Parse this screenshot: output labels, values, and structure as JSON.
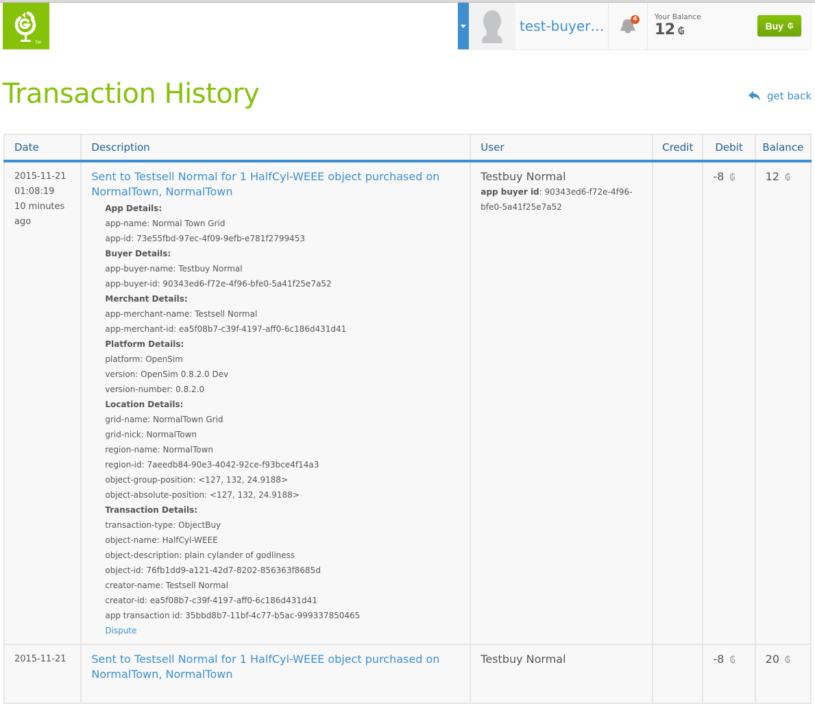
{
  "header": {
    "logo_tm": "TM",
    "username": "test-buyer…",
    "notifications_count": "4",
    "balance_label": "Your Balance",
    "balance_value": "12",
    "currency_symbol": "₲",
    "buy_label": "Buy"
  },
  "page": {
    "title": "Transaction History",
    "back_label": "get back"
  },
  "table": {
    "columns": [
      "Date",
      "Description",
      "User",
      "Credit",
      "Debit",
      "Balance"
    ],
    "rows": [
      {
        "date": "2015-11-21",
        "time": "01:08:19",
        "relative_1": "10 minutes",
        "relative_2": "ago",
        "description": "Sent to Testsell Normal for 1 HalfCyl-WEEE object purchased on NormalTown, NormalTown",
        "details": [
          {
            "type": "heading",
            "text": "App Details:"
          },
          {
            "type": "line",
            "text": "app-name: Normal Town Grid"
          },
          {
            "type": "line",
            "text": "app-id: 73e55fbd-97ec-4f09-9efb-e781f2799453"
          },
          {
            "type": "heading",
            "text": "Buyer Details:"
          },
          {
            "type": "line",
            "text": "app-buyer-name: Testbuy Normal"
          },
          {
            "type": "line",
            "text": "app-buyer-id: 90343ed6-f72e-4f96-bfe0-5a41f25e7a52"
          },
          {
            "type": "heading",
            "text": "Merchant Details:"
          },
          {
            "type": "line",
            "text": "app-merchant-name: Testsell Normal"
          },
          {
            "type": "line",
            "text": "app-merchant-id: ea5f08b7-c39f-4197-aff0-6c186d431d41"
          },
          {
            "type": "heading",
            "text": "Platform Details:"
          },
          {
            "type": "line",
            "text": "platform: OpenSim"
          },
          {
            "type": "line",
            "text": "version: OpenSim 0.8.2.0 Dev"
          },
          {
            "type": "line",
            "text": "version-number: 0.8.2.0"
          },
          {
            "type": "heading",
            "text": "Location Details:"
          },
          {
            "type": "line",
            "text": "grid-name: NormalTown Grid"
          },
          {
            "type": "line",
            "text": "grid-nick: NormalTown"
          },
          {
            "type": "line",
            "text": "region-name: NormalTown"
          },
          {
            "type": "line",
            "text": "region-id: 7aeedb84-90e3-4042-92ce-f93bce4f14a3"
          },
          {
            "type": "line",
            "text": "object-group-position: <127, 132, 24.9188>"
          },
          {
            "type": "line",
            "text": "object-absolute-position: <127, 132, 24.9188>"
          },
          {
            "type": "heading",
            "text": "Transaction Details:"
          },
          {
            "type": "line",
            "text": "transaction-type: ObjectBuy"
          },
          {
            "type": "line",
            "text": "object-name: HalfCyl-WEEE"
          },
          {
            "type": "line",
            "text": "object-description: plain cylander of godliness"
          },
          {
            "type": "line",
            "text": "object-id: 76fb1dd9-a121-42d7-8202-856363f8685d"
          },
          {
            "type": "line",
            "text": "creator-name: Testsell Normal"
          },
          {
            "type": "line",
            "text": "creator-id: ea5f08b7-c39f-4197-aff0-6c186d431d41"
          },
          {
            "type": "line",
            "text": "app transaction id: 35bbd8b7-11bf-4c77-b5ac-999337850465"
          }
        ],
        "dispute_label": "Dispute",
        "user": "Testbuy Normal",
        "user_id_label": "app buyer id",
        "user_id": ": 90343ed6-f72e-4f96-bfe0-5a41f25e7a52",
        "credit": "",
        "debit": "-8",
        "balance": "12"
      },
      {
        "date": "2015-11-21",
        "description": "Sent to Testsell Normal for 1 HalfCyl-WEEE object purchased on NormalTown, NormalTown",
        "user": "Testbuy Normal",
        "credit": "",
        "debit": "-8",
        "balance": "20"
      }
    ]
  },
  "colors": {
    "brand_green": "#86c20a",
    "link_blue": "#3d8fd1",
    "header_blue": "#1f5f93",
    "badge_orange": "#e2541a"
  }
}
